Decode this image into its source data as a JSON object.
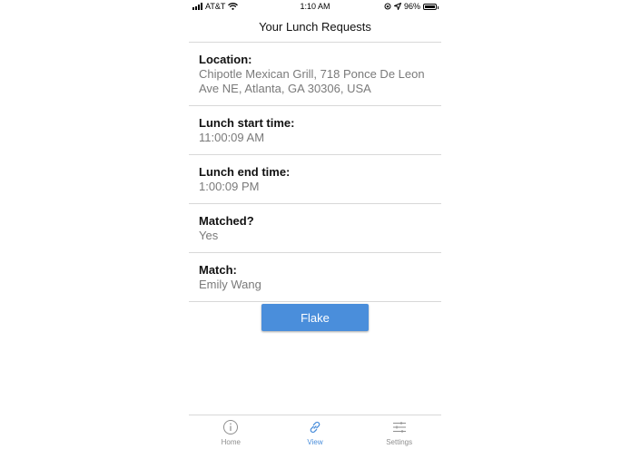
{
  "status_bar": {
    "carrier": "AT&T",
    "time": "1:10 AM",
    "battery": "96%",
    "battery_level": 0.96
  },
  "nav": {
    "title": "Your Lunch Requests"
  },
  "details": [
    {
      "label": "Location:",
      "value": "Chipotle Mexican Grill, 718 Ponce De Leon Ave NE, Atlanta, GA 30306, USA"
    },
    {
      "label": "Lunch start time:",
      "value": "11:00:09 AM"
    },
    {
      "label": "Lunch end time:",
      "value": "1:00:09 PM"
    },
    {
      "label": "Matched?",
      "value": "Yes"
    },
    {
      "label": "Match:",
      "value": "Emily Wang"
    }
  ],
  "actions": {
    "flake_label": "Flake"
  },
  "tabs": [
    {
      "label": "Home",
      "icon": "info-icon",
      "active": false
    },
    {
      "label": "View",
      "icon": "link-icon",
      "active": true
    },
    {
      "label": "Settings",
      "icon": "sliders-icon",
      "active": false
    }
  ],
  "colors": {
    "accent": "#4a8edb",
    "inactive": "#8e8e8e",
    "divider": "#d8d8d8"
  }
}
